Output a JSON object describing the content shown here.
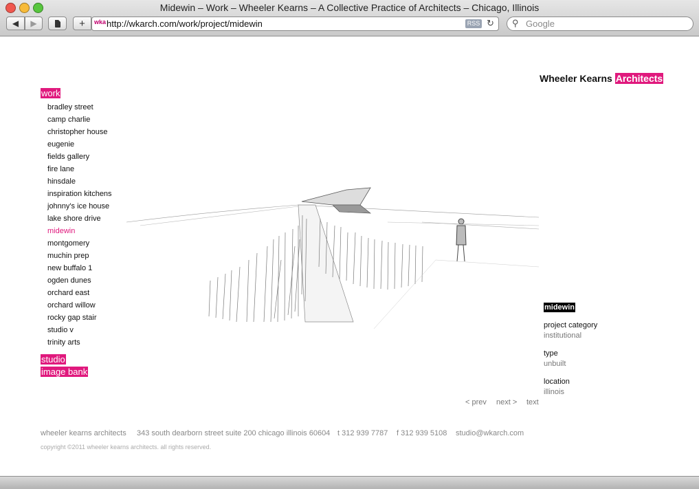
{
  "window": {
    "title": "Midewin – Work – Wheeler Kearns – A Collective Practice of Architects – Chicago, Illinois"
  },
  "toolbar": {
    "back": "◀",
    "forward": "▶",
    "add": "+",
    "favicon": "wka",
    "url": "http://wkarch.com/work/project/midewin",
    "rss": "RSS",
    "reload": "↻",
    "search_placeholder": "Google"
  },
  "brand": {
    "name": "Wheeler Kearns",
    "accent": "Architects",
    "accent_color": "#e0197d"
  },
  "nav": {
    "work": "work",
    "items": [
      "bradley street",
      "camp charlie",
      "christopher house",
      "eugenie",
      "fields gallery",
      "fire lane",
      "hinsdale",
      "inspiration kitchens",
      "johnny's ice house",
      "lake shore drive",
      "midewin",
      "montgomery",
      "muchin prep",
      "new buffalo 1",
      "ogden dunes",
      "orchard east",
      "orchard willow",
      "rocky gap stair",
      "studio v",
      "trinity arts"
    ],
    "active": "midewin",
    "studio": "studio",
    "image_bank": "image bank"
  },
  "project": {
    "name": "midewin",
    "category_label": "project category",
    "category": "institutional",
    "type_label": "type",
    "type": "unbuilt",
    "location_label": "location",
    "location": "illinois"
  },
  "pager": {
    "prev": "< prev",
    "next": "next >",
    "text": "text"
  },
  "footer": {
    "firm": "wheeler kearns architects",
    "address": "343 south dearborn street suite 200 chicago illinois 60604",
    "phone": "t 312 939 7787",
    "fax": "f 312 939 5108",
    "email": "studio@wkarch.com",
    "copyright": "copyright ©2011 wheeler kearns architects. all rights reserved."
  }
}
